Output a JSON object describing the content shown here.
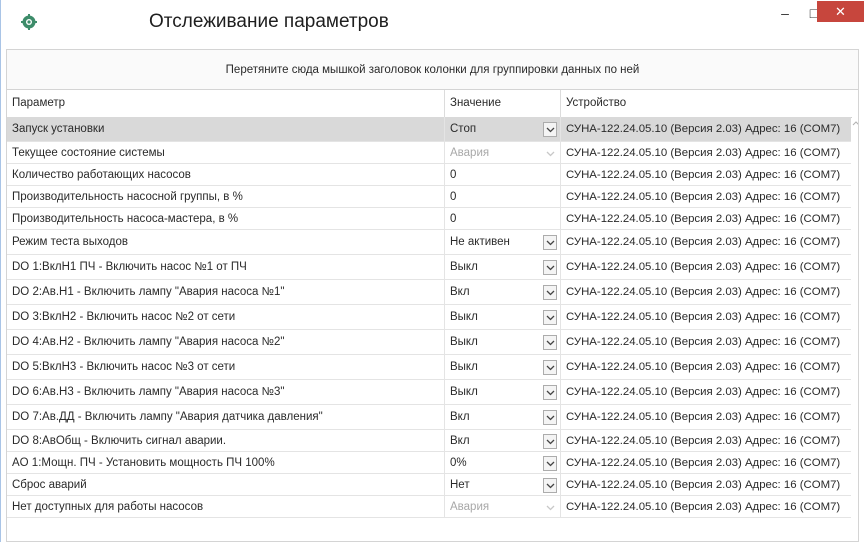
{
  "window": {
    "title": "Отслеживание параметров",
    "minimize_glyph": "–",
    "maximize_glyph": "□",
    "close_glyph": "✕",
    "close_color": "#c7463d"
  },
  "group_panel": {
    "hint": "Перетяните сюда мышкой заголовок колонки для группировки данных по ней"
  },
  "grid": {
    "columns": [
      "Параметр",
      "Значение",
      "Устройство"
    ],
    "rows": [
      {
        "param": "Запуск установки",
        "value": "Стоп",
        "dropdown": true,
        "disabled": false,
        "device": "СУНА-122.24.05.10 (Версия 2.03) Адрес: 16 (COM7)"
      },
      {
        "param": "Текущее состояние системы",
        "value": "Авария",
        "dropdown": true,
        "disabled": true,
        "device": "СУНА-122.24.05.10 (Версия 2.03) Адрес: 16 (COM7)"
      },
      {
        "param": "Количество работающих насосов",
        "value": "0",
        "dropdown": false,
        "disabled": false,
        "device": "СУНА-122.24.05.10 (Версия 2.03) Адрес: 16 (COM7)"
      },
      {
        "param": "Производительность насосной группы, в %",
        "value": "0",
        "dropdown": false,
        "disabled": false,
        "device": "СУНА-122.24.05.10 (Версия 2.03) Адрес: 16 (COM7)"
      },
      {
        "param": "Производительность насоса-мастера, в %",
        "value": "0",
        "dropdown": false,
        "disabled": false,
        "device": "СУНА-122.24.05.10 (Версия 2.03) Адрес: 16 (COM7)"
      },
      {
        "param": "Режим теста выходов",
        "value": "Не активен",
        "dropdown": true,
        "disabled": false,
        "device": "СУНА-122.24.05.10 (Версия 2.03) Адрес: 16 (COM7)"
      },
      {
        "param": "DO 1:ВклН1 ПЧ - Включить насос №1 от ПЧ",
        "value": "Выкл",
        "dropdown": true,
        "disabled": false,
        "device": "СУНА-122.24.05.10 (Версия 2.03) Адрес: 16 (COM7)"
      },
      {
        "param": "DO 2:Ав.Н1 - Включить лампу \"Авария насоса №1\"",
        "value": "Вкл",
        "dropdown": true,
        "disabled": false,
        "device": "СУНА-122.24.05.10 (Версия 2.03) Адрес: 16 (COM7)"
      },
      {
        "param": "DO 3:ВклН2 - Включить насос №2 от сети",
        "value": "Выкл",
        "dropdown": true,
        "disabled": false,
        "device": "СУНА-122.24.05.10 (Версия 2.03) Адрес: 16 (COM7)"
      },
      {
        "param": "DO 4:Ав.Н2 - Включить лампу \"Авария насоса №2\"",
        "value": "Выкл",
        "dropdown": true,
        "disabled": false,
        "device": "СУНА-122.24.05.10 (Версия 2.03) Адрес: 16 (COM7)"
      },
      {
        "param": "DO 5:ВклН3 - Включить насос №3 от сети",
        "value": "Выкл",
        "dropdown": true,
        "disabled": false,
        "device": "СУНА-122.24.05.10 (Версия 2.03) Адрес: 16 (COM7)"
      },
      {
        "param": "DO 6:Ав.Н3 - Включить лампу \"Авария насоса №3\"",
        "value": "Выкл",
        "dropdown": true,
        "disabled": false,
        "device": "СУНА-122.24.05.10 (Версия 2.03) Адрес: 16 (COM7)"
      },
      {
        "param": "DO 7:Ав.ДД - Включить лампу \"Авария датчика давления\"",
        "value": "Вкл",
        "dropdown": true,
        "disabled": false,
        "device": "СУНА-122.24.05.10 (Версия 2.03) Адрес: 16 (COM7)"
      },
      {
        "param": "DO 8:АвОбщ - Включить сигнал аварии.",
        "value": "Вкл",
        "dropdown": true,
        "disabled": false,
        "device": "СУНА-122.24.05.10 (Версия 2.03) Адрес: 16 (COM7)"
      },
      {
        "param": "AO 1:Мощн. ПЧ - Установить мощность ПЧ 100%",
        "value": "0%",
        "dropdown": true,
        "disabled": false,
        "device": "СУНА-122.24.05.10 (Версия 2.03) Адрес: 16 (COM7)"
      },
      {
        "param": "Сброс аварий",
        "value": "Нет",
        "dropdown": true,
        "disabled": false,
        "device": "СУНА-122.24.05.10 (Версия 2.03) Адрес: 16 (COM7)"
      },
      {
        "param": "Нет доступных для работы насосов",
        "value": "Авария",
        "dropdown": true,
        "disabled": true,
        "device": "СУНА-122.24.05.10 (Версия 2.03) Адрес: 16 (COM7)"
      }
    ]
  },
  "colors": {
    "selected_row": "#d9d9d9",
    "disabled_text": "#a8a8a8",
    "app_icon_green": "#3d8c6a"
  }
}
